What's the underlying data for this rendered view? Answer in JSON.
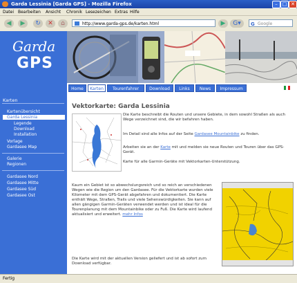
{
  "window": {
    "title": "Garda Lessinia [Garda GPS] - Mozilla Firefox"
  },
  "menu": [
    "Datei",
    "Bearbeiten",
    "Ansicht",
    "Chronik",
    "Lesezeichen",
    "Extras",
    "Hilfe"
  ],
  "nav": {
    "url": "http://www.garda-gps.de/karten.html",
    "search_placeholder": "Google"
  },
  "logo": {
    "line1": "Garda",
    "line2": "GPS"
  },
  "sidebar": {
    "heading": "Karten",
    "items": [
      {
        "label": "Kartenübersicht",
        "level": 1,
        "active": false
      },
      {
        "label": "Garda Lessinia",
        "level": 1,
        "active": true
      },
      {
        "label": "Legende",
        "level": 2,
        "active": false
      },
      {
        "label": "Download",
        "level": 2,
        "active": false
      },
      {
        "label": "Installation",
        "level": 2,
        "active": false
      },
      {
        "label": "Vorlage",
        "level": 1,
        "active": false
      },
      {
        "label": "Gardasee Map",
        "level": 1,
        "active": false
      },
      {
        "label": "Galerie",
        "level": 1,
        "active": false
      },
      {
        "label": "Regionen",
        "level": 1,
        "active": false
      },
      {
        "label": "Gardasee Nord",
        "level": 1,
        "active": false
      },
      {
        "label": "Gardasee Mitte",
        "level": 1,
        "active": false
      },
      {
        "label": "Gardasee Süd",
        "level": 1,
        "active": false
      },
      {
        "label": "Gardasee Ost",
        "level": 1,
        "active": false
      }
    ]
  },
  "tabs": [
    {
      "label": "Home",
      "active": false
    },
    {
      "label": "Karten",
      "active": true
    },
    {
      "label": "Tourenfahrer",
      "active": false
    },
    {
      "label": "Download",
      "active": false
    },
    {
      "label": "Links",
      "active": false
    },
    {
      "label": "News",
      "active": false
    },
    {
      "label": "Impressum",
      "active": false
    }
  ],
  "content": {
    "title": "Vektorkarte: Garda Lessinia",
    "p1": "Die Karte beschreibt die Routen und unsere Gebiete, in dem sowohl Straßen als auch Wege verzeichnet sind, die wir befahren haben.",
    "p2_prefix": "Im Detail sind alle Infos auf der Seite",
    "p2_link": "Gardasee Mountainbike",
    "p2_suffix": "zu finden.",
    "p3_prefix": "Arbeiten sie an der",
    "p3_link": "Karte",
    "p3_suffix": "mit und melden sie neue Routen und Touren über das GPS-Gerät.",
    "p4": "Karte für alle Garmin-Geräte mit Vektorkarten-Unterstützung.",
    "body": "Kaum ein Gebiet ist so abwechslungsreich und so reich an verschiedenen Wegen wie die Region um den Gardasee. Für die Vektorkarte wurden viele Kilometer mit dem GPS-Gerät abgefahren und dokumentiert. Die Karte enthält Wege, Straßen, Trails und viele Sehenswürdigkeiten. Sie kann auf allen gängigen Garmin-Geräten verwendet werden und ist ideal für die Tourenplanung mit dem Mountainbike oder zu Fuß. Die Karte wird laufend aktualisiert und erweitert.",
    "more_link": "mehr Infos",
    "body2": "Die Karte wird mit der aktuellen Version geliefert und ist ab sofort zum Download verfügbar."
  },
  "statusbar": {
    "text": "Fertig"
  },
  "colors": {
    "brand": "#3a6fd6",
    "titlebar": "#2b5fc7",
    "gps_map": "#f1d200"
  }
}
